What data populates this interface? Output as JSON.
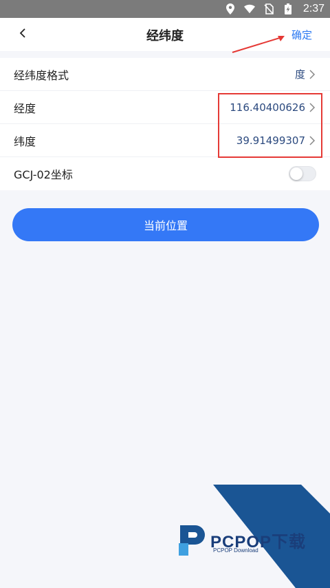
{
  "status_bar": {
    "time": "2:37",
    "icons": [
      "location-icon",
      "wifi-icon",
      "no-sim-icon",
      "battery-charging-icon"
    ]
  },
  "header": {
    "title": "经纬度",
    "back_icon": "chevron-left-icon",
    "confirm_label": "确定"
  },
  "settings": {
    "format": {
      "label": "经纬度格式",
      "value": "度"
    },
    "longitude": {
      "label": "经度",
      "value": "116.40400626"
    },
    "latitude": {
      "label": "纬度",
      "value": "39.91499307"
    },
    "gcj02": {
      "label": "GCJ-02坐标",
      "enabled": false
    }
  },
  "action": {
    "current_location_label": "当前位置"
  },
  "watermark": {
    "title": "PCPOP下载",
    "subtitle": "PCPOP Download"
  },
  "colors": {
    "accent": "#3478f6",
    "link": "#2d7af2",
    "value_text": "#2c4a7f",
    "annotation": "#e53935",
    "status_bar": "#7b7b7b",
    "background": "#f5f6fa"
  }
}
